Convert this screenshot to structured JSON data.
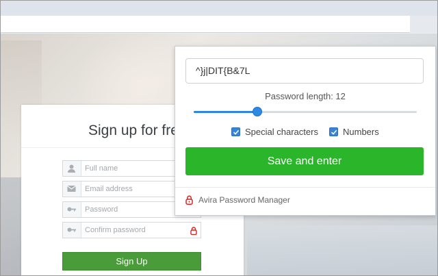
{
  "background_form": {
    "title": "Sign up for free",
    "fields": [
      {
        "placeholder": "Full name",
        "icon": "user-icon"
      },
      {
        "placeholder": "Email address",
        "icon": "envelope-icon"
      },
      {
        "placeholder": "Password",
        "icon": "key-icon"
      },
      {
        "placeholder": "Confirm password",
        "icon": "key-icon"
      }
    ],
    "submit_label": "Sign Up"
  },
  "password_popup": {
    "generated_password": "^}j|DIT{B&7L",
    "length_label": "Password length: 12",
    "length": 12,
    "length_range": [
      4,
      32
    ],
    "options": [
      {
        "label": "Special characters",
        "checked": true
      },
      {
        "label": "Numbers",
        "checked": true
      }
    ],
    "save_label": "Save and enter",
    "brand_label": "Avira Password Manager"
  },
  "colors": {
    "save_button": "#2bb52b",
    "signup_button": "#4a9b3a",
    "slider_accent": "#2f89e3",
    "avira_red": "#d9221f"
  }
}
